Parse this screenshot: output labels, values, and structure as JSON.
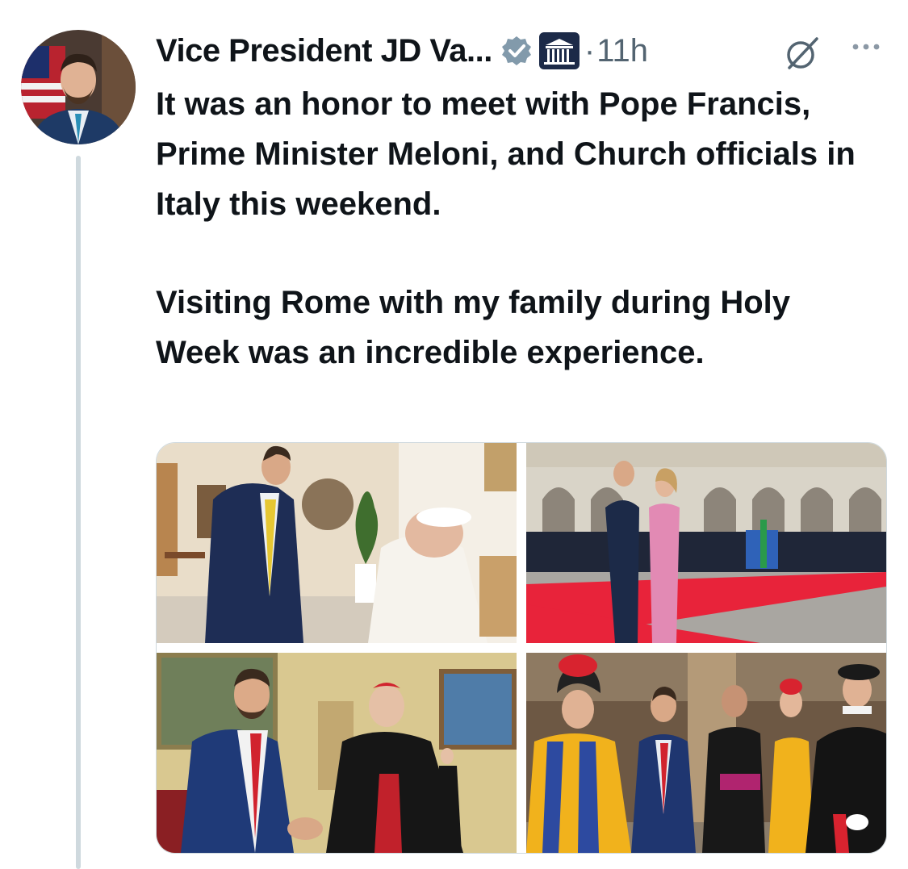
{
  "author": {
    "display_name": "Vice President JD Va...",
    "avatar_icon": "avatar-icon",
    "verified_icon": "verified-badge-icon",
    "affiliation_icon": "white-house-badge-icon"
  },
  "tweet": {
    "separator": "·",
    "time": "11h",
    "paragraph1": "It was an honor to meet with Pope Francis, Prime Minister Meloni, and Church officials in Italy this weekend.",
    "paragraph2": "Visiting Rome with my family during Holy Week was an incredible experience."
  },
  "actions": {
    "grok_icon": "grok-icon",
    "more_icon": "more-icon"
  },
  "media": {
    "photos": [
      {
        "icon": "photo-pope-meeting-icon"
      },
      {
        "icon": "photo-meloni-meeting-icon"
      },
      {
        "icon": "photo-cardinal-meeting-icon"
      },
      {
        "icon": "photo-swiss-guard-icon"
      }
    ]
  },
  "colors": {
    "text": "#0f1419",
    "secondary": "#536471",
    "verified": "#829aab",
    "thread_line": "#cfd9de",
    "red_carpet": "#e8233a"
  }
}
